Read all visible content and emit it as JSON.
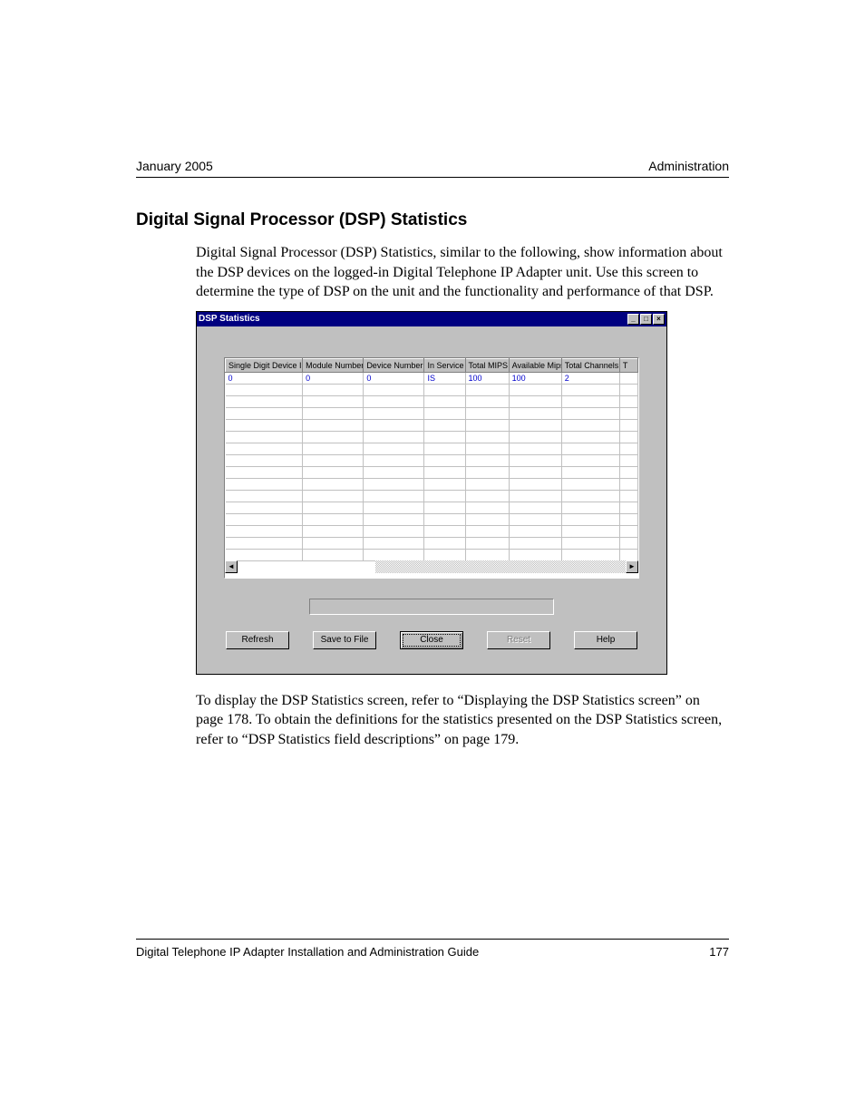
{
  "header": {
    "left": "January 2005",
    "right": "Administration"
  },
  "section_title": "Digital Signal Processor (DSP) Statistics",
  "intro_text": "Digital Signal Processor (DSP) Statistics, similar to the following, show information about the DSP devices on the logged-in Digital Telephone IP Adapter unit. Use this screen to determine the type of DSP on the unit and the functionality and performance of that DSP.",
  "outro_text": "To display the DSP Statistics screen, refer to “Displaying the DSP Statistics screen” on page 178. To obtain the definitions for the statistics presented on the DSP Statistics screen, refer to “DSP Statistics field descriptions” on page 179.",
  "window": {
    "title": "DSP Statistics",
    "columns": [
      "Single Digit Device ID",
      "Module Number",
      "Device Number",
      "In Service",
      "Total MIPS",
      "Available Mips",
      "Total Channels",
      "T"
    ],
    "rows": [
      {
        "c0": "0",
        "c1": "0",
        "c2": "0",
        "c3": "IS",
        "c4": "100",
        "c5": "100",
        "c6": "2",
        "c7": ""
      }
    ],
    "buttons": {
      "refresh": "Refresh",
      "save": "Save to File",
      "close": "Close",
      "reset": "Reset",
      "help": "Help"
    }
  },
  "footer": {
    "left": "Digital Telephone IP Adapter Installation and Administration Guide",
    "right": "177"
  }
}
